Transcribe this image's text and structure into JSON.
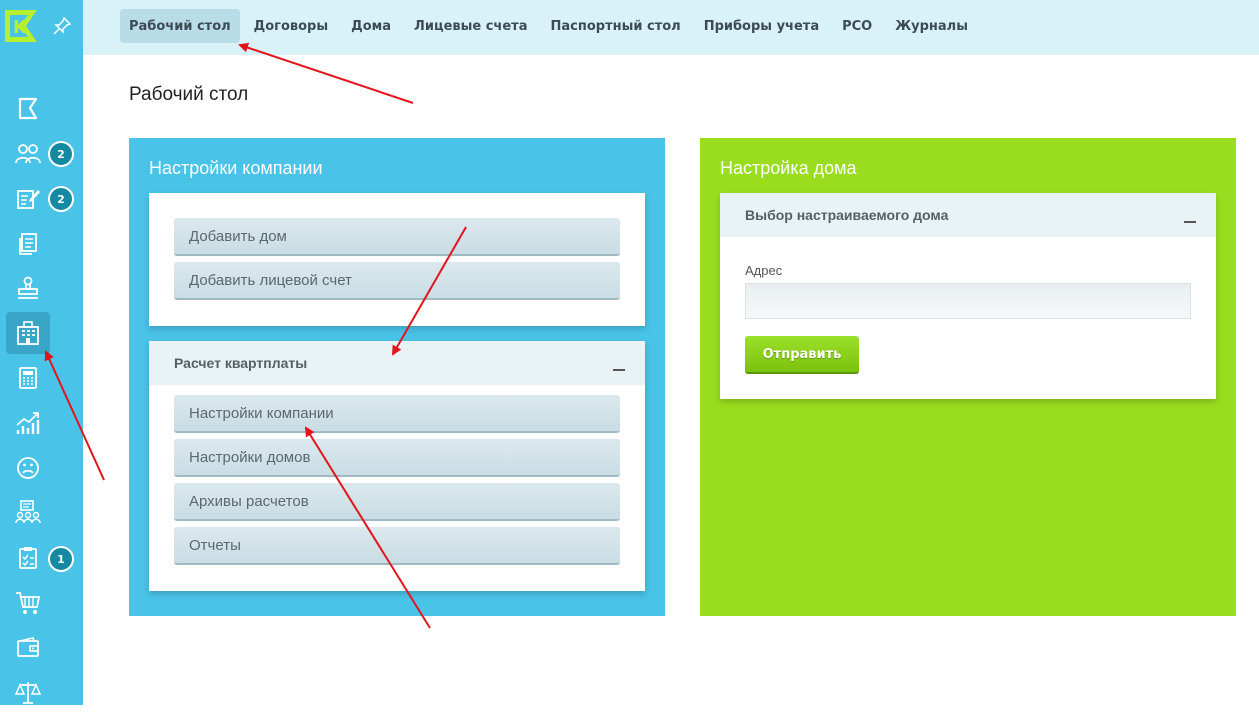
{
  "sidebar": {
    "logo_letter": "K",
    "items": [
      {
        "icon": "flag-icon"
      },
      {
        "icon": "users-group-icon",
        "badge": "2"
      },
      {
        "icon": "edit-document-icon",
        "badge": "2"
      },
      {
        "icon": "documents-icon"
      },
      {
        "icon": "stamp-icon"
      },
      {
        "icon": "building-icon",
        "active": true
      },
      {
        "icon": "calculator-icon"
      },
      {
        "icon": "chart-growth-icon"
      },
      {
        "icon": "sad-face-icon"
      },
      {
        "icon": "team-board-icon"
      },
      {
        "icon": "checklist-icon",
        "badge": "1"
      },
      {
        "icon": "cart-icon"
      },
      {
        "icon": "wallet-icon"
      },
      {
        "icon": "scales-icon"
      }
    ]
  },
  "topbar": {
    "menu": [
      {
        "label": "Рабочий стол",
        "active": true
      },
      {
        "label": "Договоры"
      },
      {
        "label": "Дома"
      },
      {
        "label": "Лицевые счета"
      },
      {
        "label": "Паспортный стол"
      },
      {
        "label": "Приборы учета"
      },
      {
        "label": "РСО"
      },
      {
        "label": "Журналы"
      }
    ]
  },
  "page": {
    "title": "Рабочий стол"
  },
  "company_panel": {
    "title": "Настройки компании",
    "quick_buttons": [
      "Добавить дом",
      "Добавить лицевой счет"
    ],
    "calc_section": {
      "title": "Расчет квартплаты",
      "buttons": [
        "Настройки компании",
        "Настройки домов",
        "Архивы расчетов",
        "Отчеты"
      ]
    }
  },
  "house_panel": {
    "title": "Настройка дома",
    "section_title": "Выбор настраиваемого дома",
    "address_label": "Адрес",
    "address_value": "",
    "submit_label": "Отправить"
  },
  "colors": {
    "sidebar": "#49c3e7",
    "topbar": "#d8f2f8",
    "company_panel": "#49c3e7",
    "house_panel": "#99dd1e",
    "annotation_arrow": "#e3141b"
  }
}
